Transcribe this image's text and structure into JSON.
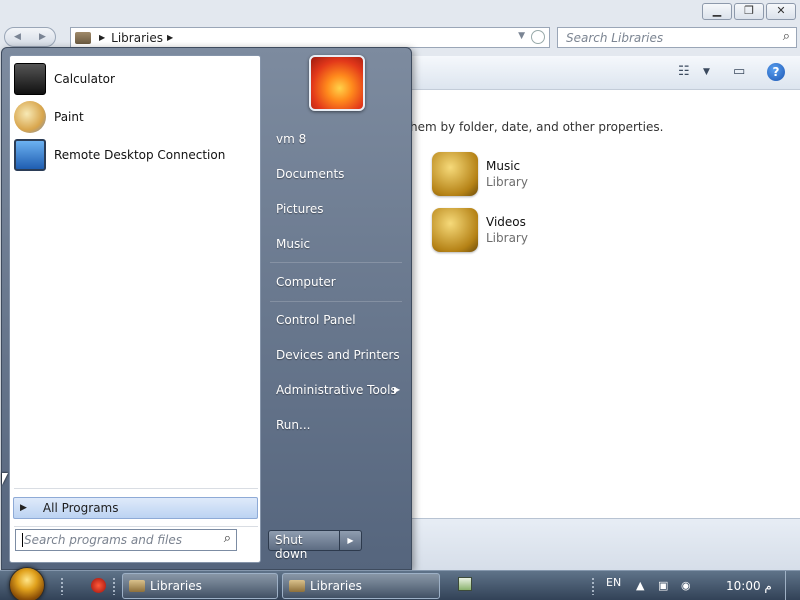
{
  "explorer": {
    "address": {
      "crumb": "Libraries"
    },
    "search": {
      "placeholder": "Search Libraries"
    },
    "content": {
      "description": "hem by folder, date, and other properties.",
      "libraries": [
        {
          "name": "Music",
          "type": "Library"
        },
        {
          "name": "Videos",
          "type": "Library"
        }
      ]
    }
  },
  "start_menu": {
    "programs": [
      {
        "label": "Calculator",
        "icon": "calculator-icon"
      },
      {
        "label": "Paint",
        "icon": "paint-icon"
      },
      {
        "label": "Remote Desktop Connection",
        "icon": "remote-desktop-icon"
      }
    ],
    "all_programs": "All Programs",
    "search_placeholder": "Search programs and files",
    "right": {
      "user": "vm 8",
      "documents": "Documents",
      "pictures": "Pictures",
      "music": "Music",
      "computer": "Computer",
      "control_panel": "Control Panel",
      "devices": "Devices and Printers",
      "admin_tools": "Administrative Tools",
      "run": "Run..."
    },
    "shutdown": "Shut down"
  },
  "taskbar": {
    "buttons": [
      {
        "label": "Libraries"
      },
      {
        "label": "Libraries"
      }
    ],
    "language": "EN",
    "clock": "10:00 م"
  }
}
